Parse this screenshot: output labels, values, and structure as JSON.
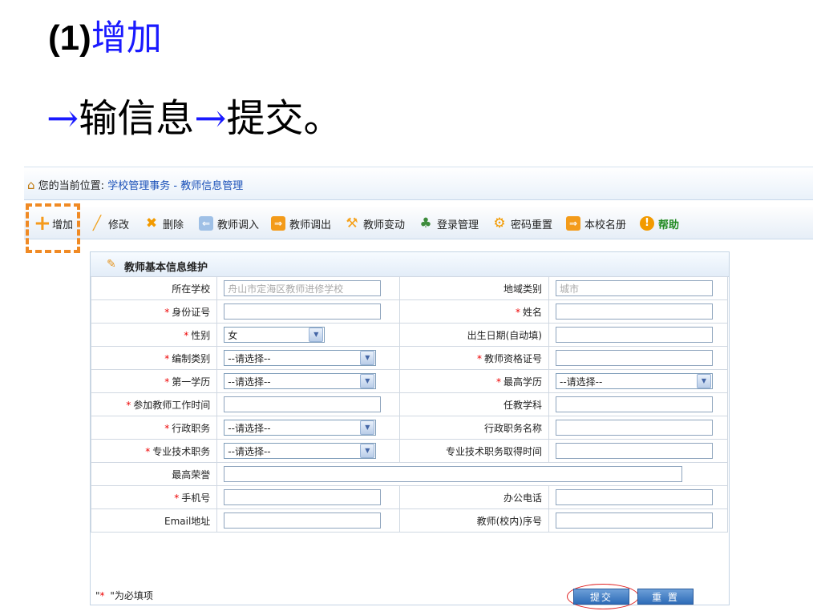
{
  "slide": {
    "heading_num": "(1)",
    "heading_action": "增加",
    "step_arrow1": "→",
    "step_part1": "输信息",
    "step_arrow2": "→",
    "step_part2": "提交。"
  },
  "breadcrumb": {
    "prefix": "您的当前位置:",
    "section": "学校管理事务",
    "separator": "-",
    "page": "教师信息管理"
  },
  "toolbar": {
    "items": [
      {
        "label": "增加",
        "icon": "plus-icon"
      },
      {
        "label": "修改",
        "icon": "pencil-icon"
      },
      {
        "label": "删除",
        "icon": "delete-x-icon"
      },
      {
        "label": "教师调入",
        "icon": "import-icon"
      },
      {
        "label": "教师调出",
        "icon": "export-icon"
      },
      {
        "label": "教师变动",
        "icon": "wrench-icon"
      },
      {
        "label": "登录管理",
        "icon": "user-key-icon"
      },
      {
        "label": "密码重置",
        "icon": "gear-icon"
      },
      {
        "label": "本校名册",
        "icon": "roster-icon"
      },
      {
        "label": "帮助",
        "icon": "info-icon"
      }
    ]
  },
  "form": {
    "title": "教师基本信息维护",
    "labels": {
      "school": "所在学校",
      "region": "地域类别",
      "id_no": "身份证号",
      "name": "姓名",
      "gender": "性别",
      "birth": "出生日期(自动填)",
      "staffing": "编制类别",
      "qual_cert": "教师资格证号",
      "first_edu": "第一学历",
      "highest_edu": "最高学历",
      "start_time": "参加教师工作时间",
      "subject": "任教学科",
      "admin_post": "行政职务",
      "admin_post_name": "行政职务名称",
      "tech_post": "专业技术职务",
      "tech_post_time": "专业技术职务取得时间",
      "honor": "最高荣誉",
      "mobile": "手机号",
      "office_phone": "办公电话",
      "email": "Email地址",
      "school_seq": "教师(校内)序号"
    },
    "values": {
      "school": "舟山市定海区教师进修学校",
      "region": "城市",
      "gender": "女",
      "staffing": "--请选择--",
      "first_edu": "--请选择--",
      "highest_edu": "--请选择--",
      "admin_post": "--请选择--",
      "tech_post": "--请选择--"
    },
    "required_mark": "*",
    "required_note_open": "\"",
    "required_note_rest": " \"为必填项",
    "submit_label": "提交",
    "reset_label": "重 置"
  }
}
